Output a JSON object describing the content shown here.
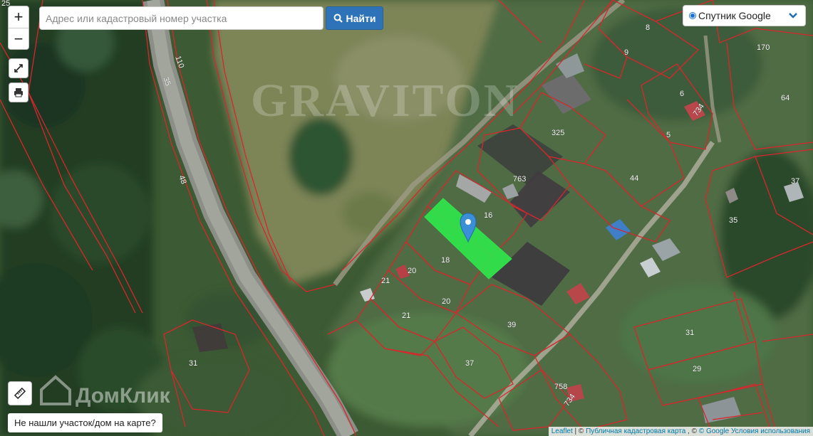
{
  "map": {
    "watermark": "GRAVITON",
    "brand_watermark": "ДомКлик",
    "parcel_labels": [
      {
        "id": "top-left-25",
        "text": "25"
      },
      {
        "id": "road-110",
        "text": "110"
      },
      {
        "id": "road-35",
        "text": "35"
      },
      {
        "id": "road-48",
        "text": "48"
      },
      {
        "id": "p8",
        "text": "8"
      },
      {
        "id": "p9",
        "text": "9"
      },
      {
        "id": "p170",
        "text": "170"
      },
      {
        "id": "p64",
        "text": "64"
      },
      {
        "id": "p6",
        "text": "6"
      },
      {
        "id": "p734a",
        "text": "734"
      },
      {
        "id": "p5",
        "text": "5"
      },
      {
        "id": "p325",
        "text": "325"
      },
      {
        "id": "p763",
        "text": "763"
      },
      {
        "id": "p44",
        "text": "44"
      },
      {
        "id": "p37a",
        "text": "37"
      },
      {
        "id": "p16",
        "text": "16"
      },
      {
        "id": "p35",
        "text": "35"
      },
      {
        "id": "p18",
        "text": "18"
      },
      {
        "id": "p20a",
        "text": "20"
      },
      {
        "id": "p21a",
        "text": "21"
      },
      {
        "id": "p20b",
        "text": "20"
      },
      {
        "id": "p21b",
        "text": "21"
      },
      {
        "id": "p39",
        "text": "39"
      },
      {
        "id": "p31a",
        "text": "31"
      },
      {
        "id": "p29",
        "text": "29"
      },
      {
        "id": "p37b",
        "text": "37"
      },
      {
        "id": "p31b",
        "text": "31"
      },
      {
        "id": "p758",
        "text": "758"
      },
      {
        "id": "p734b",
        "text": "734"
      }
    ]
  },
  "controls": {
    "zoom_in": "+",
    "zoom_out": "−"
  },
  "search": {
    "placeholder": "Адрес или кадастровый номер участка",
    "value": "",
    "button_label": "Найти"
  },
  "layer_selector": {
    "selected": "Спутник Google"
  },
  "not_found_link": "Не нашли участок/дом на карте?",
  "attribution": {
    "leaflet": "Leaflet",
    "sep1": " | © ",
    "pkk": "Публичная кадастровая карта",
    "sep2": " , © ",
    "google": "© Google",
    "terms": "Условия использования"
  },
  "colors": {
    "parcel_border": "#d9262c",
    "label_color": "#ffffff",
    "selected_parcel": "#2ee84a",
    "marker": "#3b8fd6",
    "button": "#2e73b8"
  }
}
